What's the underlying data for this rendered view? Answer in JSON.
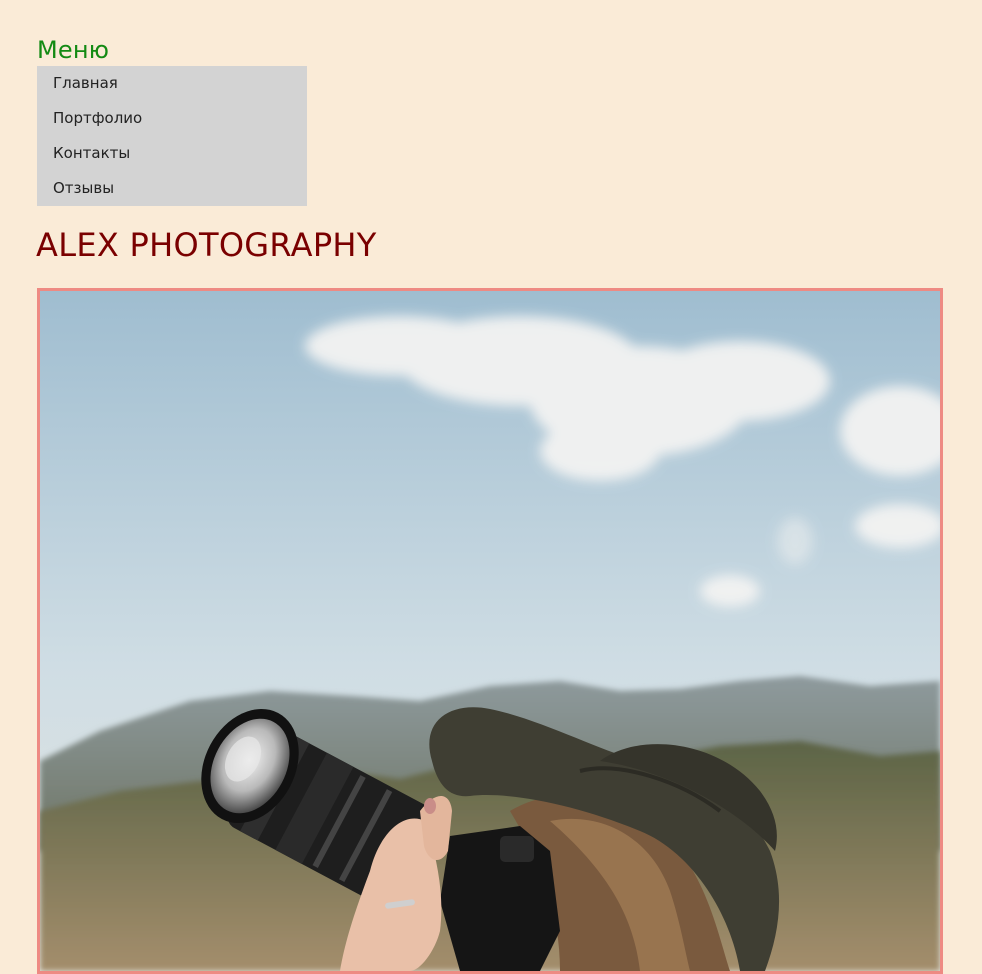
{
  "menu": {
    "heading": "Меню",
    "items": [
      {
        "label": "Главная"
      },
      {
        "label": "Портфолио"
      },
      {
        "label": "Контакты"
      },
      {
        "label": "Отзывы"
      }
    ]
  },
  "site": {
    "title": "ALEX PHOTOGRAPHY"
  },
  "colors": {
    "background": "#faebd7",
    "menu_heading": "#138a13",
    "menu_bg": "#d3d3d3",
    "title": "#7a0000",
    "image_border": "#ee8a83"
  },
  "hero": {
    "image_alt": "photographer-with-camera-photo"
  }
}
